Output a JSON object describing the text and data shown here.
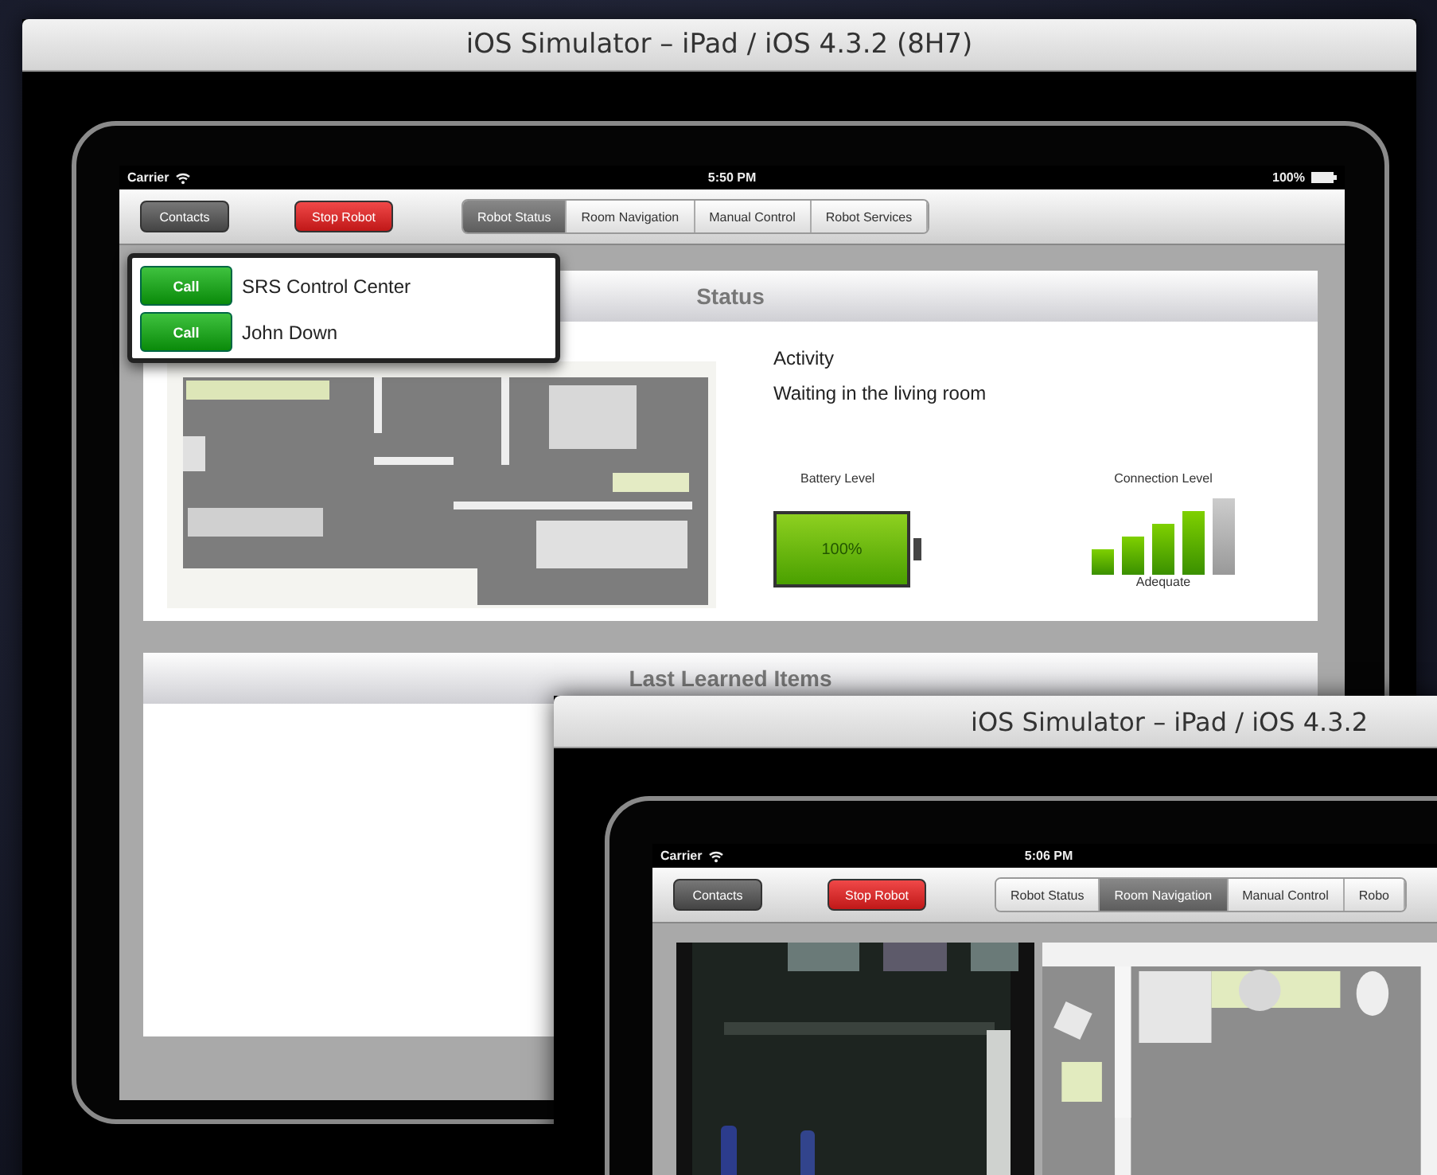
{
  "windows": [
    {
      "title": "iOS Simulator – iPad / iOS 4.3.2 (8H7)",
      "status_bar": {
        "carrier": "Carrier",
        "time": "5:50 PM",
        "battery": "100%"
      },
      "toolbar": {
        "contacts": "Contacts",
        "stop": "Stop Robot",
        "segments": [
          {
            "label": "Robot Status",
            "selected": true
          },
          {
            "label": "Room Navigation",
            "selected": false
          },
          {
            "label": "Manual Control",
            "selected": false
          },
          {
            "label": "Robot Services",
            "selected": false
          }
        ]
      },
      "popover": {
        "contacts": [
          {
            "action": "Call",
            "name": "SRS Control Center"
          },
          {
            "action": "Call",
            "name": "John Down"
          }
        ]
      },
      "status_panel": {
        "title": "Status",
        "activity_label": "Activity",
        "activity": "Waiting in the living room",
        "battery": {
          "label": "Battery Level",
          "level": 1.0,
          "reading": "100%"
        },
        "connection": {
          "label": "Connection Level",
          "level": 0.8,
          "reading": "Adequate"
        }
      },
      "last_learned": {
        "title": "Last Learned Items"
      }
    },
    {
      "title": "iOS Simulator – iPad / iOS 4.3.2",
      "status_bar": {
        "carrier": "Carrier",
        "time": "5:06 PM"
      },
      "toolbar": {
        "contacts": "Contacts",
        "stop": "Stop Robot",
        "segments": [
          {
            "label": "Robot Status",
            "selected": false
          },
          {
            "label": "Room Navigation",
            "selected": true
          },
          {
            "label": "Manual Control",
            "selected": false
          },
          {
            "label": "Robo",
            "selected": false
          }
        ]
      }
    }
  ]
}
